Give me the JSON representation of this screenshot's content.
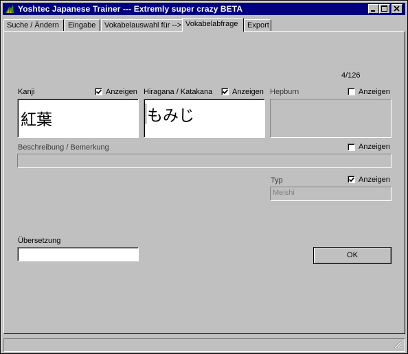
{
  "window": {
    "title": "Yoshtec Japanese Trainer  --- Extremly super crazy BETA",
    "icon": "app-leaf-icon",
    "controls": [
      "minimize-icon",
      "maximize-icon",
      "close-icon"
    ]
  },
  "tabs": [
    {
      "label": "Suche / Ändern"
    },
    {
      "label": "Eingabe"
    },
    {
      "label": "Vokabelauswahl für -->"
    },
    {
      "label": "Vokabelabfrage",
      "active": true
    },
    {
      "label": "Export"
    }
  ],
  "quiz": {
    "counter": "4/126",
    "kanji": {
      "label": "Kanji",
      "show_label": "Anzeigen",
      "checked": true,
      "value": "紅葉"
    },
    "kana": {
      "label": "Hiragana / Katakana",
      "show_label": "Anzeigen",
      "checked": true,
      "value": "もみじ"
    },
    "hepburn": {
      "label": "Hepburn",
      "show_label": "Anzeigen",
      "checked": false,
      "value": ""
    },
    "description": {
      "label": "Beschreibung / Bemerkung",
      "show_label": "Anzeigen",
      "checked": false,
      "value": ""
    },
    "type": {
      "label": "Typ",
      "show_label": "Anzeigen",
      "checked": true,
      "value": "Meishi"
    },
    "translation": {
      "label": "Übersetzung",
      "value": ""
    },
    "ok_label": "OK"
  },
  "colors": {
    "face": "#c0c0c0",
    "titlebar": "#000080",
    "title_text": "#ffffff"
  }
}
